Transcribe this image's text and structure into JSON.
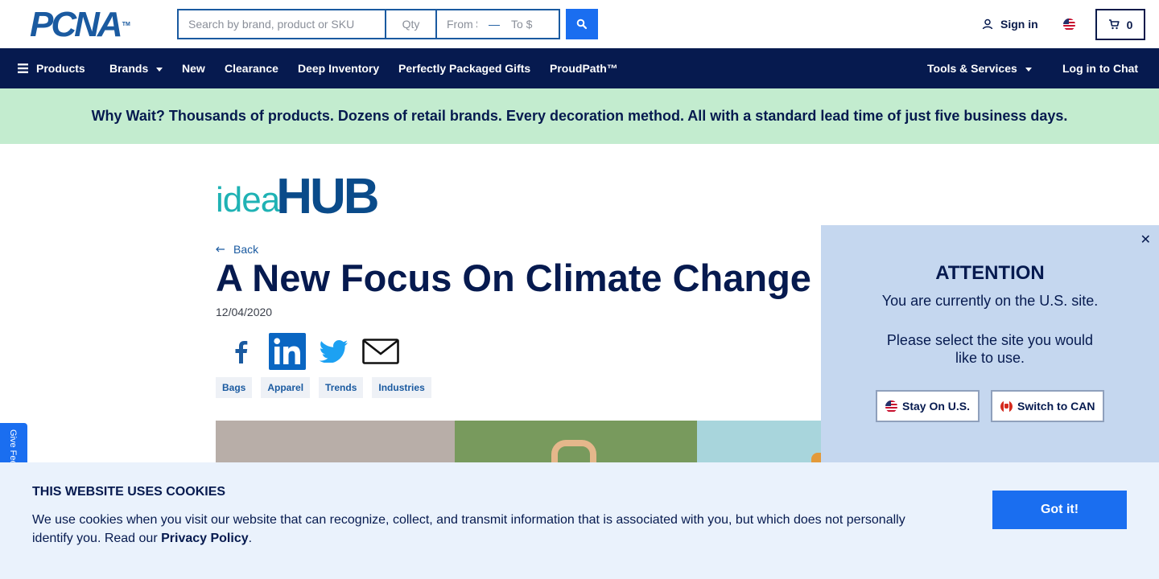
{
  "header": {
    "logo_text": "PCNA",
    "logo_tm": "TM",
    "search_placeholder": "Search by brand, product or SKU",
    "qty_placeholder": "Qty",
    "price_from_placeholder": "From $",
    "price_to_placeholder": "To $",
    "signin_label": "Sign in",
    "cart_count": "0"
  },
  "nav": {
    "products": "Products",
    "brands": "Brands",
    "new": "New",
    "clearance": "Clearance",
    "deep_inventory": "Deep Inventory",
    "gifts": "Perfectly Packaged Gifts",
    "proudpath": "ProudPath™",
    "tools": "Tools & Services",
    "chat": "Log in to Chat"
  },
  "promo": {
    "text": "Why Wait? Thousands of products. Dozens of retail brands. Every decoration method. All with a standard lead time of just five business days."
  },
  "article": {
    "brand_idea": "idea",
    "brand_hub": "HUB",
    "back_label": "Back",
    "title": "A New Focus On Climate Change",
    "date": "12/04/2020",
    "tags": [
      "Bags",
      "Apparel",
      "Trends",
      "Industries"
    ]
  },
  "feedback": {
    "label": "Give Feedback"
  },
  "country_modal": {
    "heading": "ATTENTION",
    "line1": "You are currently on the U.S. site.",
    "line2": "Please select the site you would like to use.",
    "stay_label": "Stay On U.S.",
    "switch_label": "Switch to CAN"
  },
  "cookie": {
    "heading": "THIS WEBSITE USES COOKIES",
    "text": "We use cookies when you visit our website that can recognize, collect, and transmit information that is associated with you, but which does not personally identify you. Read our ",
    "link": "Privacy Policy",
    "end": ".",
    "button": "Got it!"
  },
  "colors": {
    "navy": "#061a4f",
    "brand_blue": "#1a5aa0",
    "action_blue": "#1a6ef0",
    "promo_bg": "#c3eccf",
    "modal_bg": "#c5d7ef",
    "cookie_bg": "#eaf2fc"
  }
}
